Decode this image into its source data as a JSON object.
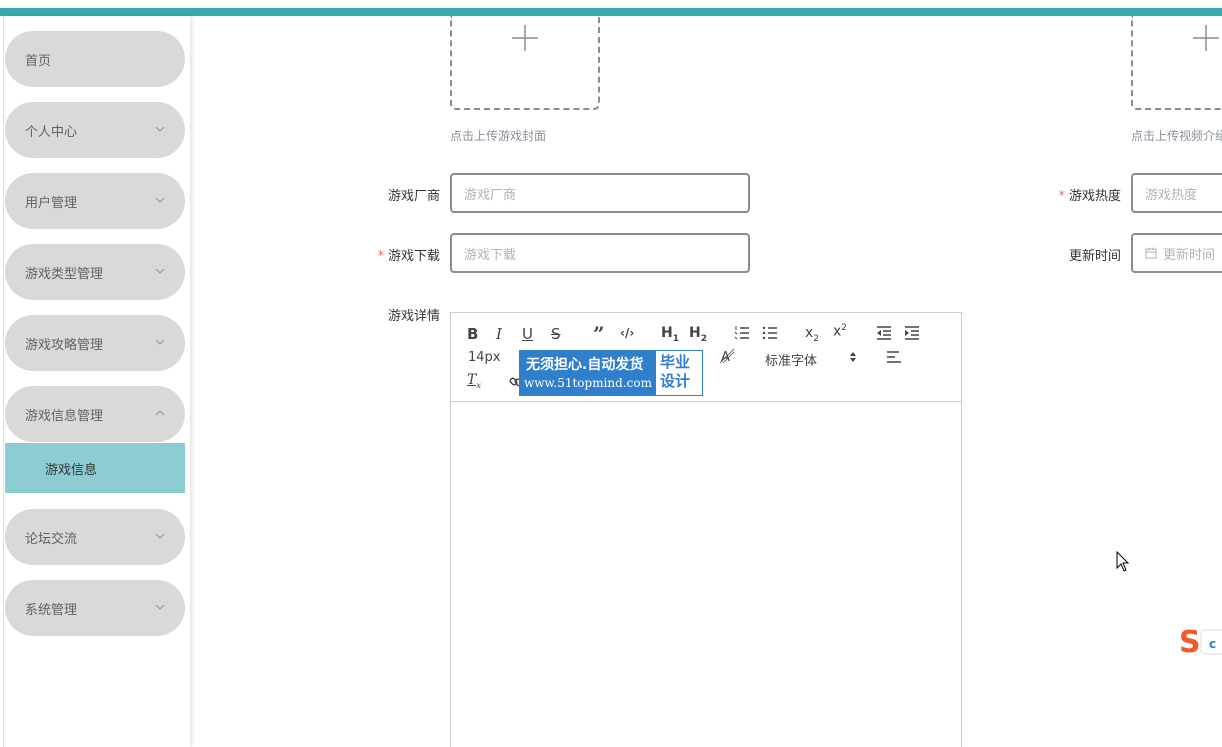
{
  "sidebar": {
    "items": [
      {
        "label": "首页",
        "has_chevron": false
      },
      {
        "label": "个人中心",
        "has_chevron": true
      },
      {
        "label": "用户管理",
        "has_chevron": true
      },
      {
        "label": "游戏类型管理",
        "has_chevron": true
      },
      {
        "label": "游戏攻略管理",
        "has_chevron": true
      },
      {
        "label": "游戏信息管理",
        "has_chevron": true,
        "expanded": true
      },
      {
        "label": "论坛交流",
        "has_chevron": true
      },
      {
        "label": "系统管理",
        "has_chevron": true
      }
    ],
    "subitem": {
      "label": "游戏信息"
    }
  },
  "form": {
    "cover_hint": "点击上传游戏封面",
    "video_hint": "点击上传视频介绍",
    "vendor": {
      "label": "游戏厂商",
      "placeholder": "游戏厂商"
    },
    "heat": {
      "label": "游戏热度",
      "placeholder": "游戏热度"
    },
    "download": {
      "label": "游戏下载",
      "placeholder": "游戏下载"
    },
    "update_time": {
      "label": "更新时间",
      "placeholder": "更新时间"
    },
    "details": {
      "label": "游戏详情"
    }
  },
  "editor": {
    "font_size": "14px",
    "font_family": "标准字体",
    "tools": [
      "bold",
      "italic",
      "underline",
      "strike",
      "blockquote",
      "code-block",
      "h1",
      "h2",
      "ordered-list",
      "bullet-list",
      "subscript",
      "superscript",
      "outdent",
      "indent",
      "color",
      "background",
      "align",
      "clean-format",
      "link"
    ]
  },
  "watermark": {
    "line1": "无须担心.自动发货",
    "line2": "www.51topmind.com",
    "right_line1": "毕业",
    "right_line2": "设计"
  },
  "colors": {
    "accent": "#3aa8ad",
    "active_submenu": "#8ccdd4",
    "menu_bg": "#d9d9d9",
    "required": "#f56c6c"
  }
}
